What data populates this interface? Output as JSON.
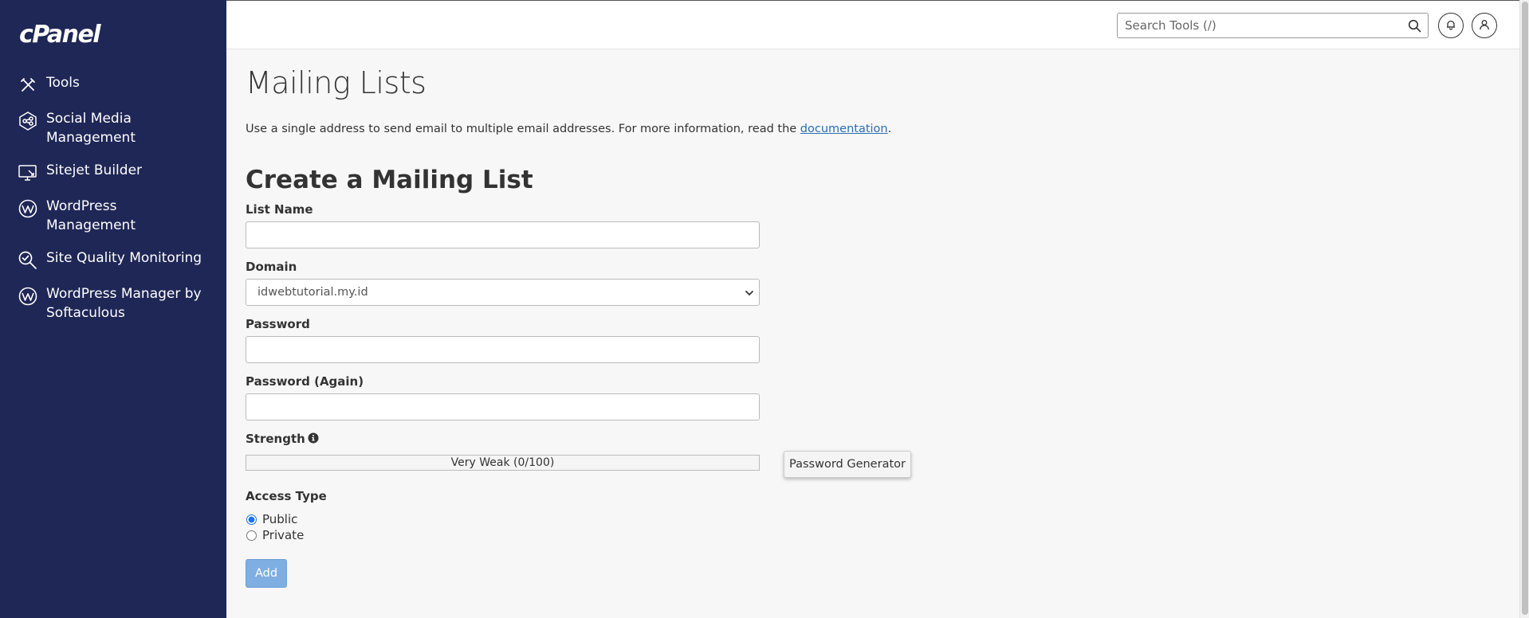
{
  "brand": {
    "logo_text": "cPanel"
  },
  "sidebar": {
    "items": [
      {
        "label": "Tools",
        "icon": "tools-icon"
      },
      {
        "label": "Social Media Management",
        "icon": "social-media-icon"
      },
      {
        "label": "Sitejet Builder",
        "icon": "sitejet-icon"
      },
      {
        "label": "WordPress Management",
        "icon": "wordpress-icon"
      },
      {
        "label": "Site Quality Monitoring",
        "icon": "site-quality-icon"
      },
      {
        "label": "WordPress Manager by Softaculous",
        "icon": "wordpress-icon"
      }
    ]
  },
  "header": {
    "search_placeholder": "Search Tools (/)"
  },
  "main": {
    "page_title": "Mailing Lists",
    "description_prefix": "Use a single address to send email to multiple email addresses. For more information, read the ",
    "description_link": "documentation",
    "description_suffix": ".",
    "section_title": "Create a Mailing List",
    "form": {
      "list_name_label": "List Name",
      "list_name_value": "",
      "domain_label": "Domain",
      "domain_value": "idwebtutorial.my.id",
      "password_label": "Password",
      "password_again_label": "Password (Again)",
      "strength_label": "Strength",
      "strength_text": "Very Weak (0/100)",
      "strength_value": 0,
      "password_generator_label": "Password Generator",
      "access_type_label": "Access Type",
      "access_options": [
        {
          "label": "Public",
          "checked": true
        },
        {
          "label": "Private",
          "checked": false
        }
      ],
      "add_label": "Add"
    }
  },
  "colors": {
    "sidebar_bg": "#1f2756",
    "link": "#2b6eb3",
    "add_button": "#7eaee2",
    "radio_accent": "#1a73e8"
  }
}
